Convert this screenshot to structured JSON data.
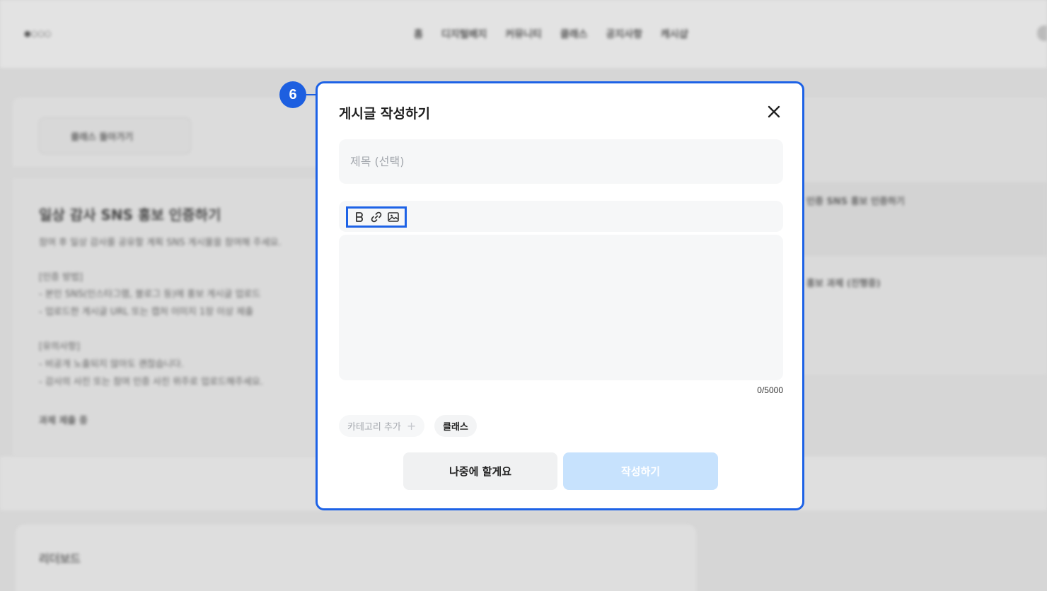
{
  "background": {
    "nav_items": [
      "홈",
      "디지털배지",
      "커뮤니티",
      "클래스",
      "공지사항",
      "캐시샵"
    ],
    "back_button_label": "클래스 돌아가기",
    "post_title": "일상 감사 SNS 홍보 인증하기",
    "post_lines": [
      "참여 후 일상 감사를 공유할 계획 SNS 게시물을 참여해 주세요.",
      "[인증 방법]",
      "- 본인 SNS(인스타그램, 블로그 등)에 홍보 게시글 업로드",
      "- 업로드한 게시글 URL 또는 캡처 이미지 1장 이상 제출",
      "[유의사항]",
      "- 비공개 노출되지 않아도 괜찮습니다.",
      "- 감사의 사진 또는 참여 인증 사진 위주로 업로드해주세요.",
      "과제 제출 중"
    ],
    "right_lines": [
      "인증 SNS 홍보 인증하기",
      "홍보 과제 (진행중)"
    ],
    "bottom_label": "리더보드"
  },
  "step_badge": "6",
  "modal": {
    "title": "게시글 작성하기",
    "close_icon": "close-icon",
    "title_placeholder": "제목 (선택)",
    "toolbar": {
      "bold_icon": "bold-icon",
      "link_icon": "link-icon",
      "image_icon": "image-icon"
    },
    "content_value": "",
    "char_counter": "0/5000",
    "category_add_label": "카테고리 추가",
    "category_add_icon": "+",
    "category_selected": "클래스",
    "later_button": "나중에 할게요",
    "submit_button": "작성하기"
  },
  "colors": {
    "accent": "#1d62e6",
    "submit_disabled": "#c7e2fd",
    "input_bg": "#f6f7f8"
  }
}
